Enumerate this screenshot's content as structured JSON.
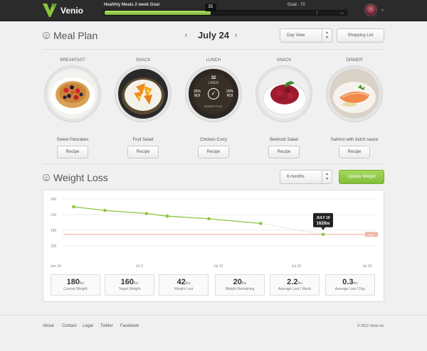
{
  "app": {
    "name": "Venio"
  },
  "goal": {
    "title": "Healthly Meals 2 week Goal",
    "current": 35,
    "target_label": "Goal - 70",
    "max": 80,
    "end_label": "80"
  },
  "meal_plan": {
    "title": "Meal Plan",
    "date": "July 24",
    "view_select": "Day View",
    "shopping_list": "Shopping List",
    "recipe_label": "Recipe",
    "meals": [
      {
        "type": "BREAKFAST",
        "name": "Sweet Pancakes"
      },
      {
        "type": "SNACK",
        "name": "Fruit Salad"
      },
      {
        "type": "LUNCH",
        "name": "Chicken Curry",
        "likes_count": "32",
        "likes_label": "LIKES",
        "left_pct": "35%",
        "left_lbl": "NDI",
        "right_pct": "20%",
        "right_lbl": "RDI",
        "substitute": "SUBSTITUE"
      },
      {
        "type": "SNACK",
        "name": "Beetroot Salad"
      },
      {
        "type": "DINNER",
        "name": "Salmon with dutch sauce"
      }
    ]
  },
  "weight_loss": {
    "title": "Weight Loss",
    "period_select": "6 months",
    "update_button": "Update Weight",
    "stats": [
      {
        "value": "180",
        "unit": "lbs",
        "label": "Current Weight"
      },
      {
        "value": "160",
        "unit": "lbs",
        "label": "Target Weight"
      },
      {
        "value": "42",
        "unit": "lbs",
        "label": "Weight Lost"
      },
      {
        "value": "20",
        "unit": "lbs",
        "label": "Weight Remaining"
      },
      {
        "value": "2.2",
        "unit": "lbs",
        "label": "Average Lost / Week"
      },
      {
        "value": "0.3",
        "unit": "lbs",
        "label": "Average Lost / Day"
      }
    ]
  },
  "chart_data": {
    "type": "line",
    "y_ticks": [
      240,
      210,
      180,
      150
    ],
    "ylim": [
      150,
      240
    ],
    "x_tick_labels": [
      "Jun 24",
      "Jul 2",
      "Jul 10",
      "Jul 18",
      "Jul 24"
    ],
    "goal_value": 172,
    "goal_label": "Goal",
    "series": [
      {
        "values": [
          {
            "x": "Jun 25",
            "y": 225
          },
          {
            "x": "Jun 28",
            "y": 218
          },
          {
            "x": "Jul 2",
            "y": 212
          },
          {
            "x": "Jul 4",
            "y": 207
          },
          {
            "x": "Jul 8",
            "y": 202
          },
          {
            "x": "Jul 13",
            "y": 193
          }
        ]
      }
    ],
    "projection": {
      "x": "Jul 19",
      "y": 172
    },
    "tooltip": {
      "date": "JULY 19",
      "value": "162",
      "unit": "lbs"
    },
    "grid": true
  },
  "footer": {
    "links": [
      "About",
      "Contact",
      "Legal",
      "Twitter",
      "Facebook"
    ],
    "copyright": "© 2012 Venio Inc"
  },
  "colors": {
    "accent": "#8cc63f",
    "goal_line": "#f0b9a9",
    "topbar": "#2b2b2b"
  }
}
